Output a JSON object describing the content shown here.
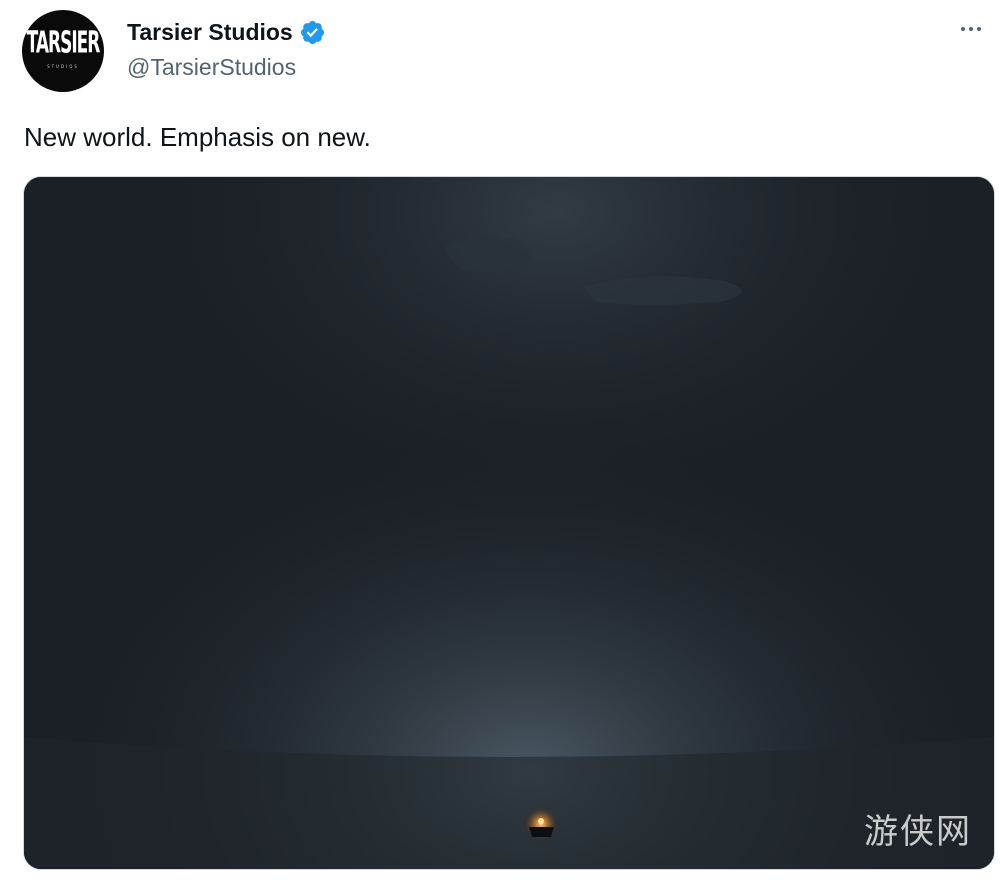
{
  "author": {
    "display_name": "Tarsier Studios",
    "handle": "@TarsierStudios",
    "avatar_text": "TARSIER",
    "avatar_subtext": "STUDIOS",
    "verified_color": "#1d9bf0"
  },
  "tweet": {
    "text": "New world. Emphasis on new."
  },
  "media": {
    "watermark": "游侠网"
  },
  "icons": {
    "more": "more-horizontal-icon",
    "verified": "verified-badge-icon"
  }
}
